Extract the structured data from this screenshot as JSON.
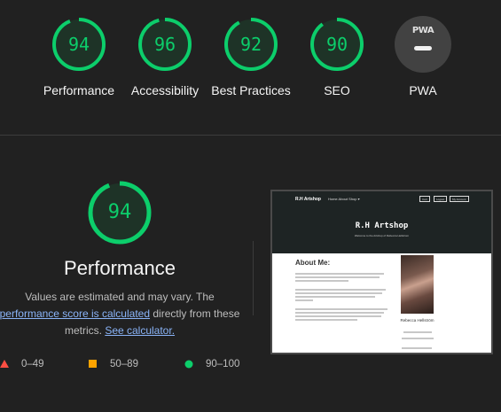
{
  "categories": [
    {
      "label": "Performance",
      "score": "94",
      "value": 94
    },
    {
      "label": "Accessibility",
      "score": "96",
      "value": 96
    },
    {
      "label": "Best Practices",
      "score": "92",
      "value": 92
    },
    {
      "label": "SEO",
      "score": "90",
      "value": 90
    }
  ],
  "pwa": {
    "badge_text": "PWA",
    "label": "PWA"
  },
  "performance": {
    "score": "94",
    "value": 94,
    "title": "Performance",
    "desc_1": "Values are estimated and may vary. The",
    "desc_link": "performance score is calculated",
    "desc_2": "directly from these metrics.",
    "calc_link": "See calculator."
  },
  "legend": {
    "fail": "0–49",
    "average": "50–89",
    "pass": "90–100"
  },
  "colors": {
    "pass": "#0cce6b",
    "average": "#ffa400",
    "fail": "#ff4e42",
    "link": "#8ab4f8"
  },
  "screenshot": {
    "brand": "R.H Artshop",
    "nav_links": "Home   About   Shop ▾",
    "cart": "Cart",
    "login": "Logout",
    "account": "My Account",
    "title": "R.H Artshop",
    "subtitle": "Welcome to the Artshop of Rebecca Hellstrom",
    "about": "About Me:",
    "name": "Rebecca Hellström"
  }
}
